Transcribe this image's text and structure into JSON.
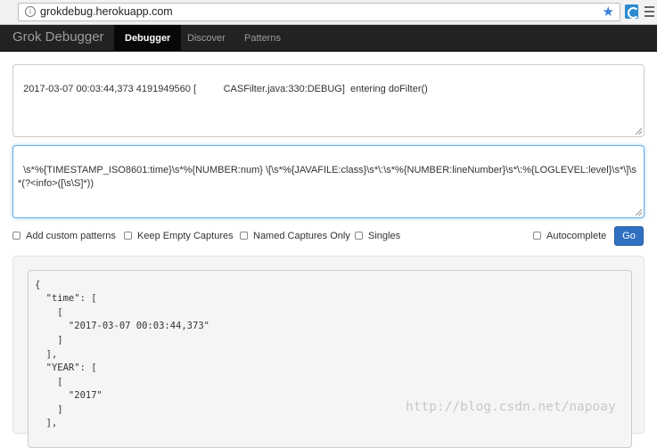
{
  "browser": {
    "url": "grokdebug.herokuapp.com"
  },
  "navbar": {
    "brand": "Grok Debugger",
    "items": [
      {
        "label": "Debugger"
      },
      {
        "label": "Discover"
      },
      {
        "label": "Patterns"
      }
    ]
  },
  "input": {
    "log_line": "2017-03-07 00:03:44,373 4191949560 [          CASFilter.java:330:DEBUG]  entering doFilter()",
    "pattern": "\\s*%{TIMESTAMP_ISO8601:time}\\s*%{NUMBER:num} \\[\\s*%{JAVAFILE:class}\\s*\\:\\s*%{NUMBER:lineNumber}\\s*\\:%{LOGLEVEL:level}\\s*\\]\\s*(?<info>([\\s\\S]*))"
  },
  "options": {
    "add_custom_patterns": "Add custom patterns",
    "keep_empty_captures": "Keep Empty Captures",
    "named_captures_only": "Named Captures Only",
    "singles": "Singles",
    "autocomplete": "Autocomplete",
    "go": "Go"
  },
  "output": {
    "lines": [
      "{",
      "  \"time\": [",
      "    [",
      "      \"2017-03-07 00:03:44,373\"",
      "    ]",
      "  ],",
      "  \"YEAR\": [",
      "    [",
      "      \"2017\"",
      "    ]",
      "  ],"
    ]
  },
  "watermark": "http://blog.csdn.net/napoay"
}
